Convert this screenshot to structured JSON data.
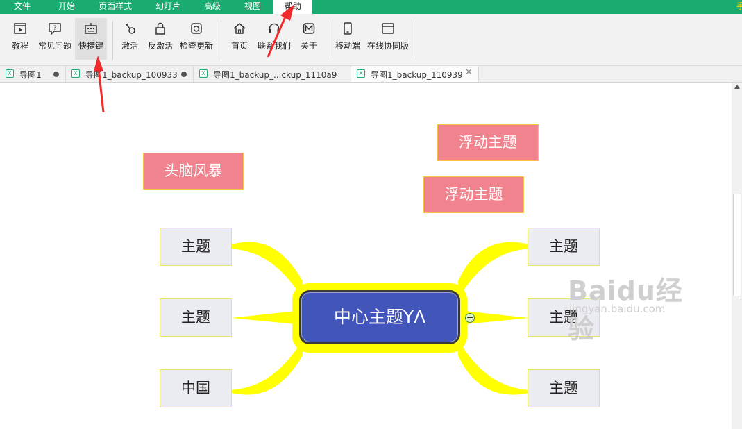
{
  "menu": {
    "items": [
      "文件",
      "开始",
      "页面样式",
      "幻灯片",
      "高级",
      "视图",
      "帮助"
    ],
    "active": "帮助",
    "right_text": "手"
  },
  "ribbon": {
    "buttons": [
      {
        "label": "教程",
        "icon": "play-video-icon"
      },
      {
        "label": "常见问题",
        "icon": "question-bubble-icon"
      },
      {
        "label": "快捷键",
        "icon": "keyboard-icon"
      },
      {
        "label": "激活",
        "icon": "key-icon"
      },
      {
        "label": "反激活",
        "icon": "lock-icon"
      },
      {
        "label": "检查更新",
        "icon": "refresh-icon"
      },
      {
        "label": "首页",
        "icon": "home-icon"
      },
      {
        "label": "联系我们",
        "icon": "headset-icon"
      },
      {
        "label": "关于",
        "icon": "about-icon"
      },
      {
        "label": "移动端",
        "icon": "phone-icon"
      },
      {
        "label": "在线协同版",
        "icon": "browser-window-icon"
      }
    ]
  },
  "tabs": [
    {
      "name": "导图1",
      "modified": true,
      "active": false
    },
    {
      "name": "导图1_backup_100933",
      "modified": true,
      "active": false
    },
    {
      "name": "导图1_backup_...ckup_1110a9",
      "modified": false,
      "active": false
    },
    {
      "name": "导图1_backup_110939",
      "modified": false,
      "active": true,
      "close": "✕"
    }
  ],
  "mindmap": {
    "center": "中心主题YΛ",
    "left_topics": [
      "主题",
      "主题",
      "中国"
    ],
    "right_topics": [
      "主题",
      "主题",
      "主题"
    ],
    "floating": [
      "头脑风暴",
      "浮动主题",
      "浮动主题"
    ],
    "branch_color": "#ffff00",
    "center_color": "#4156b8",
    "floating_color": "#f0838e"
  },
  "watermark": {
    "main": "Baidu经验",
    "sub": "jingyan.baidu.com"
  },
  "annotation_color": "#ee2a2a"
}
